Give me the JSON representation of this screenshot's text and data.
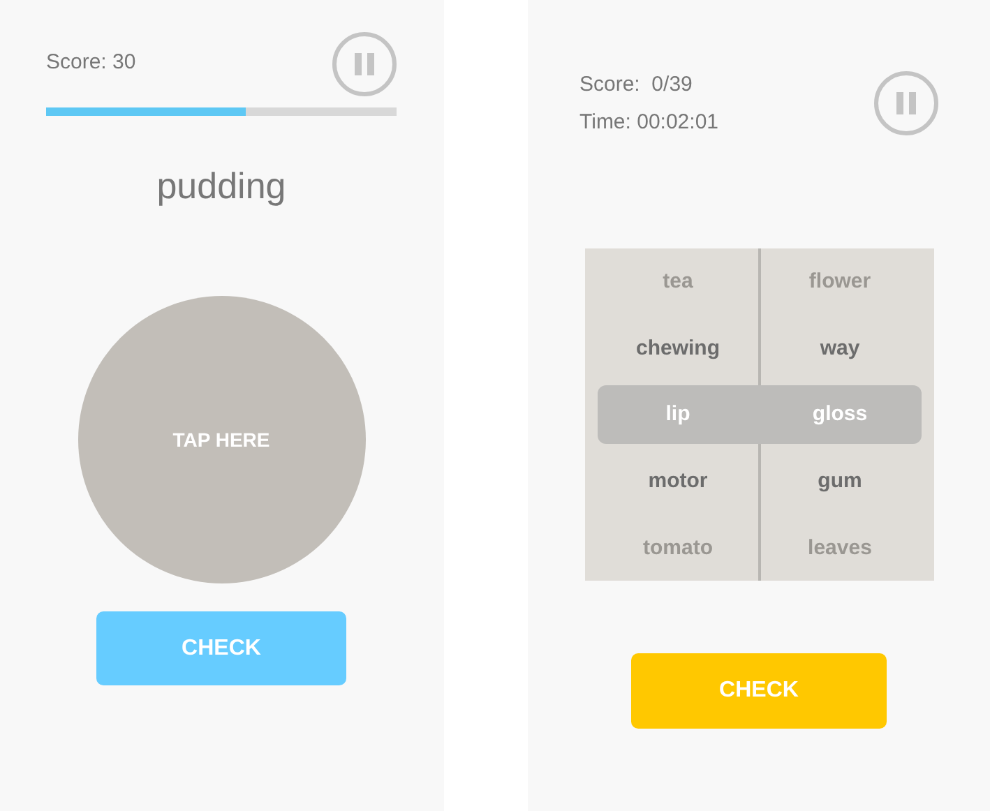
{
  "left_screen": {
    "score": "Score: 30",
    "progress": {
      "level": 0.57
    },
    "word": "pudding",
    "tap_area": "TAP HERE",
    "check_button": "CHECK"
  },
  "right_screen": {
    "score": "Score:  0/39",
    "time": "Time: 00:02:01",
    "picker": {
      "rows": [
        {
          "left": "tea",
          "right": "flower",
          "selected": false,
          "dimmed": true
        },
        {
          "left": "chewing",
          "right": "way",
          "selected": false,
          "dimmed": false
        },
        {
          "left": "lip",
          "right": "gloss",
          "selected": true,
          "dimmed": false
        },
        {
          "left": "motor",
          "right": "gum",
          "selected": false,
          "dimmed": false
        },
        {
          "left": "tomato",
          "right": "leaves",
          "selected": false,
          "dimmed": true
        }
      ]
    },
    "check_button": "CHECK"
  }
}
